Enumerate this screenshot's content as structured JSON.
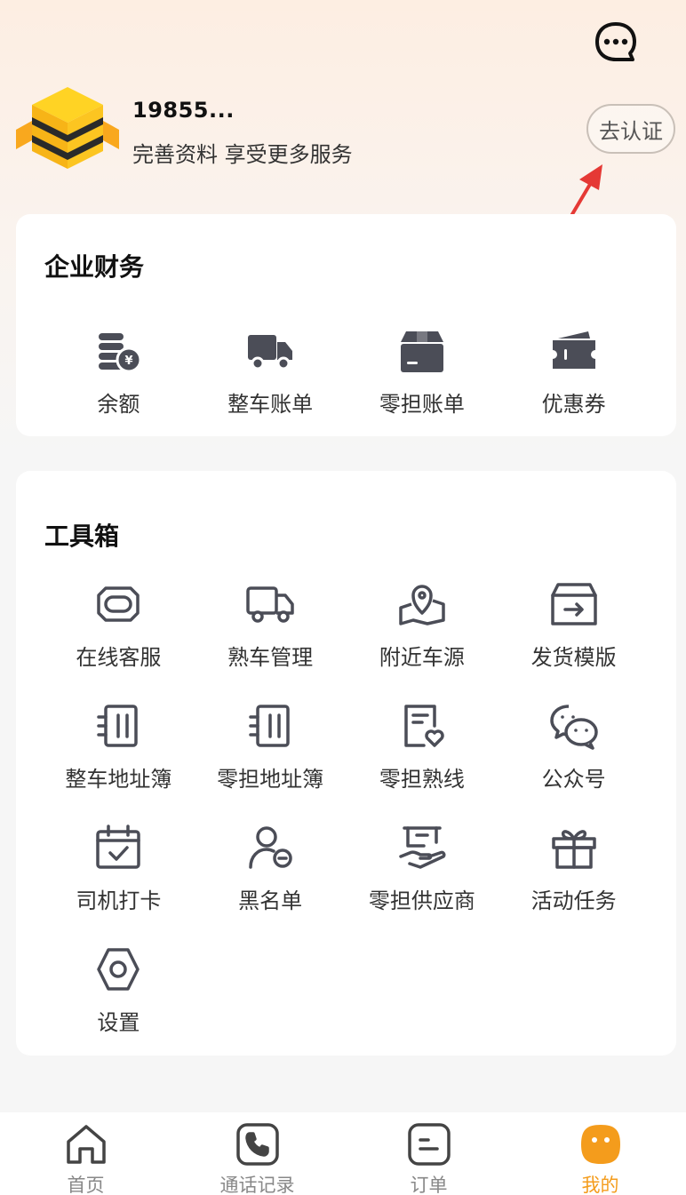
{
  "header": {
    "message_icon": "chat-bubble-icon"
  },
  "profile": {
    "username": "19855...",
    "subtitle": "完善资料 享受更多服务",
    "verify_label": "去认证"
  },
  "finance": {
    "title": "企业财务",
    "items": [
      {
        "label": "余额",
        "icon": "coins-icon"
      },
      {
        "label": "整车账单",
        "icon": "truck-icon"
      },
      {
        "label": "零担账单",
        "icon": "box-icon"
      },
      {
        "label": "优惠券",
        "icon": "coupon-icon"
      }
    ]
  },
  "toolbox": {
    "title": "工具箱",
    "items": [
      {
        "label": "在线客服",
        "icon": "headset-icon"
      },
      {
        "label": "熟车管理",
        "icon": "truck-outline-icon"
      },
      {
        "label": "附近车源",
        "icon": "map-pin-icon"
      },
      {
        "label": "发货模版",
        "icon": "template-icon"
      },
      {
        "label": "整车地址簿",
        "icon": "address-book-icon"
      },
      {
        "label": "零担地址簿",
        "icon": "address-book-icon"
      },
      {
        "label": "零担熟线",
        "icon": "doc-heart-icon"
      },
      {
        "label": "公众号",
        "icon": "wechat-icon"
      },
      {
        "label": "司机打卡",
        "icon": "calendar-check-icon"
      },
      {
        "label": "黑名单",
        "icon": "user-minus-icon"
      },
      {
        "label": "零担供应商",
        "icon": "hand-box-icon"
      },
      {
        "label": "活动任务",
        "icon": "gift-icon"
      },
      {
        "label": "设置",
        "icon": "hex-gear-icon"
      }
    ]
  },
  "tabbar": {
    "items": [
      {
        "label": "首页",
        "icon": "home-icon"
      },
      {
        "label": "通话记录",
        "icon": "phone-icon"
      },
      {
        "label": "订单",
        "icon": "order-icon"
      },
      {
        "label": "我的",
        "icon": "face-icon",
        "active": true
      }
    ]
  },
  "colors": {
    "accent": "#f49c1c",
    "icon_dark": "#4b4d57"
  }
}
